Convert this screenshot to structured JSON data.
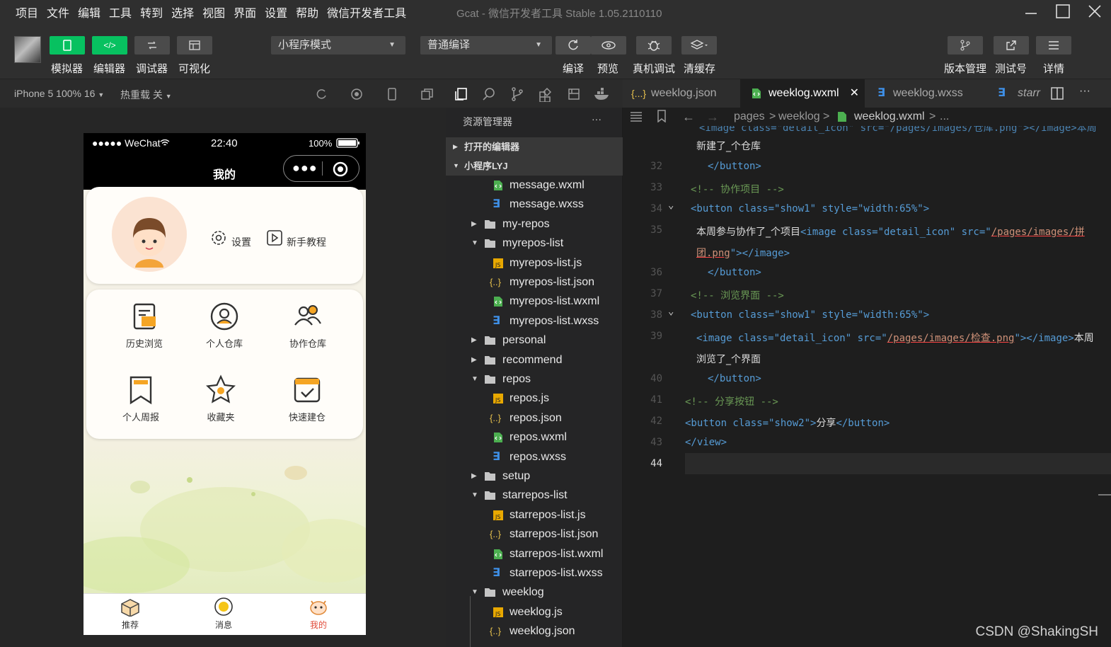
{
  "menu": [
    "项目",
    "文件",
    "编辑",
    "工具",
    "转到",
    "选择",
    "视图",
    "界面",
    "设置",
    "帮助",
    "微信开发者工具"
  ],
  "window_title": "Gcat - 微信开发者工具 Stable 1.05.2110110",
  "toolbar": {
    "simulator": "模拟器",
    "editor": "编辑器",
    "debugger": "调试器",
    "visual": "可视化",
    "mode": "小程序模式",
    "compile_mode": "普通编译",
    "compile": "编译",
    "preview": "预览",
    "remote_debug": "真机调试",
    "clear_cache": "清缓存",
    "version": "版本管理",
    "test": "测试号",
    "details": "详情"
  },
  "simbar": {
    "device": "iPhone 5 100% 16",
    "hotreload": "热重载 关"
  },
  "phone": {
    "carrier": "●●●●● WeChat",
    "time": "22:40",
    "battery": "100%",
    "title": "我的",
    "settings": "设置",
    "tutorial": "新手教程",
    "grid": [
      "历史浏览",
      "个人仓库",
      "协作仓库",
      "个人周报",
      "收藏夹",
      "快速建仓"
    ],
    "tabs": [
      "推荐",
      "消息",
      "我的"
    ]
  },
  "explorer": {
    "title": "资源管理器",
    "more": "···",
    "open_editors": "打开的编辑器",
    "project": "小程序LYJ",
    "files": [
      "message.wxml",
      "message.wxss",
      "my-repos",
      "myrepos-list",
      "myrepos-list.js",
      "myrepos-list.json",
      "myrepos-list.wxml",
      "myrepos-list.wxss",
      "personal",
      "recommend",
      "repos",
      "repos.js",
      "repos.json",
      "repos.wxml",
      "repos.wxss",
      "setup",
      "starrepos-list",
      "starrepos-list.js",
      "starrepos-list.json",
      "starrepos-list.wxml",
      "starrepos-list.wxss",
      "weeklog",
      "weeklog.js",
      "weeklog.json"
    ]
  },
  "editor": {
    "tabs": [
      "weeklog.json",
      "weeklog.wxml",
      "weeklog.wxss",
      "starr"
    ],
    "breadcrumb": [
      "pages",
      "weeklog",
      "weeklog.wxml",
      "..."
    ],
    "lines": [
      "32",
      "33",
      "34",
      "35",
      "36",
      "37",
      "38",
      "39",
      "40",
      "41",
      "42",
      "43",
      "44"
    ],
    "code": {
      "l31a": "新建了_个仓库",
      "btn_close": "</button>",
      "c33": "<!-- 协作项目 -->",
      "btn_open": "<button class=\"show1\" style=\"width:65%\">",
      "l35_text": "本周参与协作了_个项目",
      "l35_img": "<image class=\"detail_icon\" src=\"",
      "l35_url": "/pages/images/拼",
      "l35_cont": "团.png",
      "l35_end": "\"></image>",
      "c37": "<!-- 浏览界面 -->",
      "l39_img": "<image class=\"detail_icon\" src=\"",
      "l39_url": "/pages/images/检查.png",
      "l39_end": "\"></image>",
      "l39_text": "本周",
      "l39b": "浏览了_个界面",
      "c41": "<!-- 分享按钮 -->",
      "l42_open": "<button class=\"show2\">",
      "l42_text": "分享",
      "l42_close": "</button>",
      "l43": "</view>",
      "top_partial": "<image class=\"detail_icon\" src=\"/pages/images/仓库.png\"></image>本周"
    }
  },
  "watermark": "CSDN @ShakingSH",
  "colors": {
    "accent": "#07c160",
    "tab_active": "#e04b3a"
  }
}
